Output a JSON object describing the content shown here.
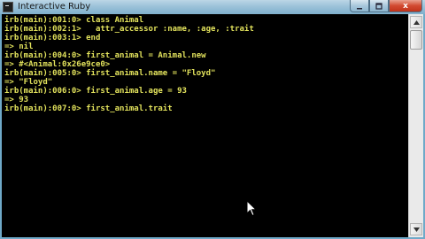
{
  "window": {
    "title": "Interactive Ruby",
    "close_glyph": "x",
    "icon": "console-icon"
  },
  "console": {
    "lines": [
      "irb(main):001:0> class Animal",
      "irb(main):002:1>   attr_accessor :name, :age, :trait",
      "irb(main):003:1> end",
      "=> nil",
      "irb(main):004:0> first_animal = Animal.new",
      "=> #<Animal:0x26e9ce0>",
      "irb(main):005:0> first_animal.name = \"Floyd\"",
      "=> \"Floyd\"",
      "irb(main):006:0> first_animal.age = 93",
      "=> 93",
      "irb(main):007:0> first_animal.trait"
    ],
    "text_color": "#e2e25c",
    "background": "#000000"
  },
  "scrollbar": {
    "up_icon": "arrow-up-icon",
    "down_icon": "arrow-down-icon"
  }
}
